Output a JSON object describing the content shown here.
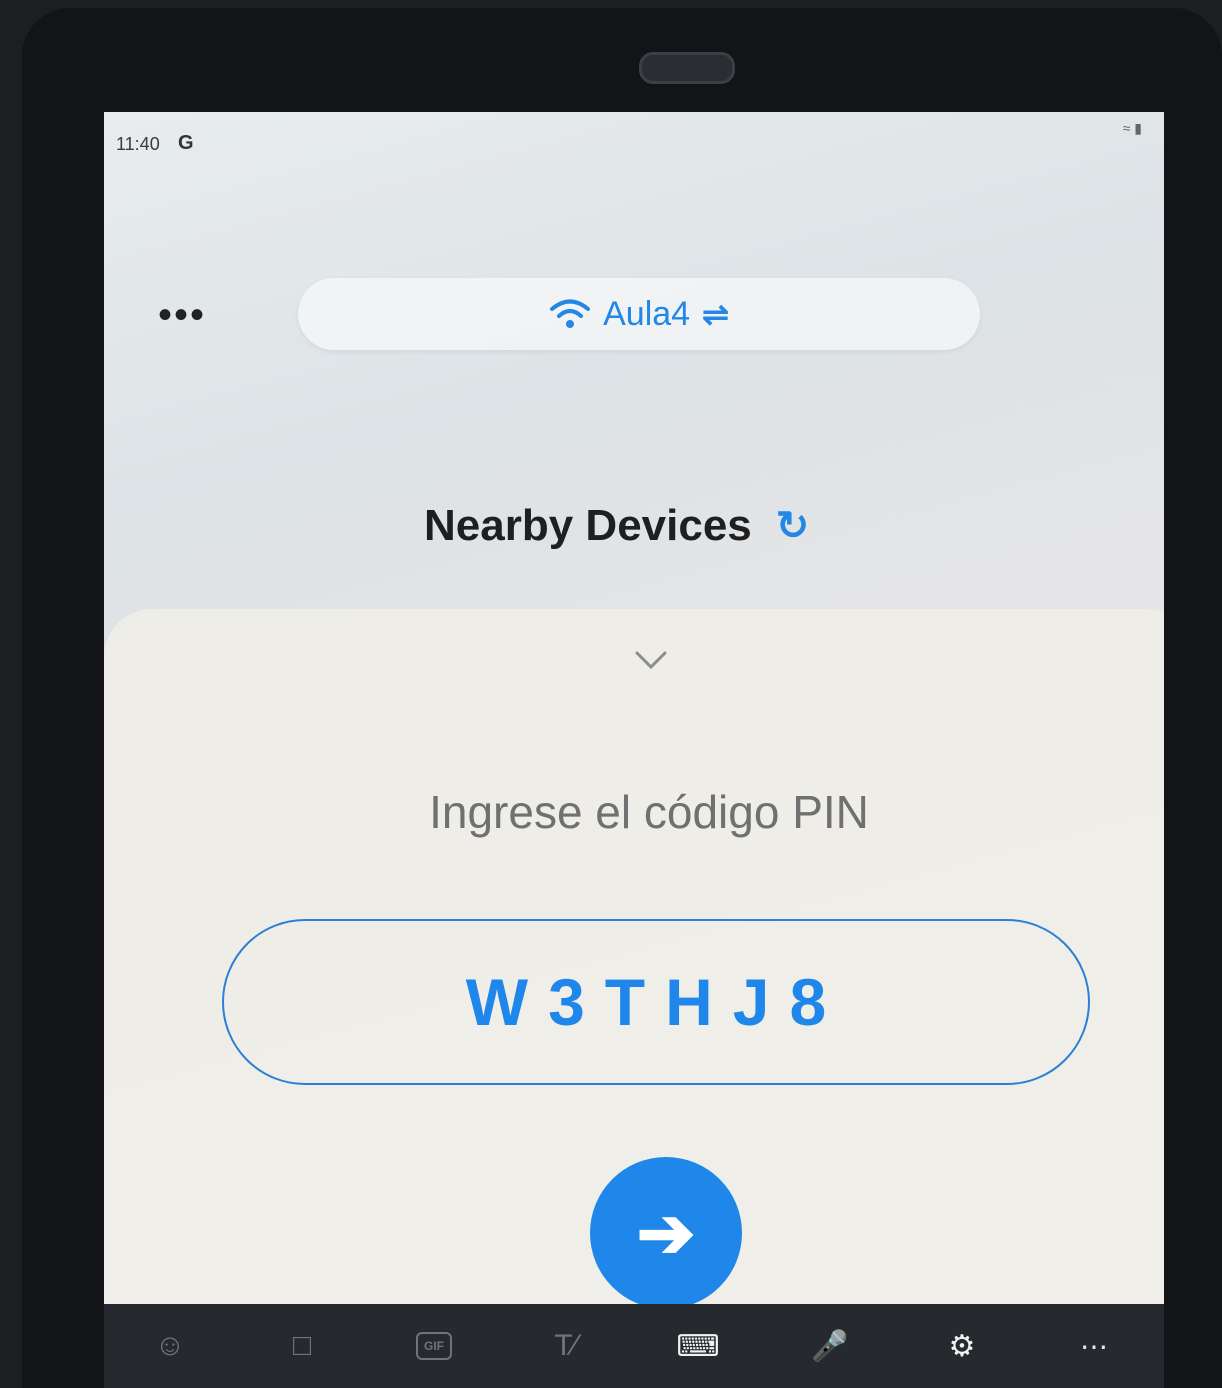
{
  "status_bar": {
    "time": "11:40",
    "google_badge": "G",
    "icons": [
      "wifi-icon",
      "battery-icon"
    ]
  },
  "network": {
    "name": "Aula4",
    "icons": [
      "wifi-icon",
      "swap-icon"
    ]
  },
  "header": {
    "more_icon": "more-icon",
    "title": "Nearby Devices",
    "refresh_icon": "refresh-icon"
  },
  "pin_sheet": {
    "collapse_icon": "chevron-down-icon",
    "label": "Ingrese el código PIN",
    "pin_value": "W3THJ8",
    "submit_icon": "arrow-right-icon"
  },
  "keyboard_toolbar": {
    "items": [
      "emoji",
      "sticker",
      "gif",
      "handwriting",
      "keyboard",
      "voice",
      "settings",
      "more"
    ],
    "gif_label": "GIF",
    "active_item": "keyboard"
  },
  "colors": {
    "accent": "#1f86ea",
    "title": "#1f1f1f",
    "label": "#707070",
    "keyboard_bg": "#262a2f"
  }
}
